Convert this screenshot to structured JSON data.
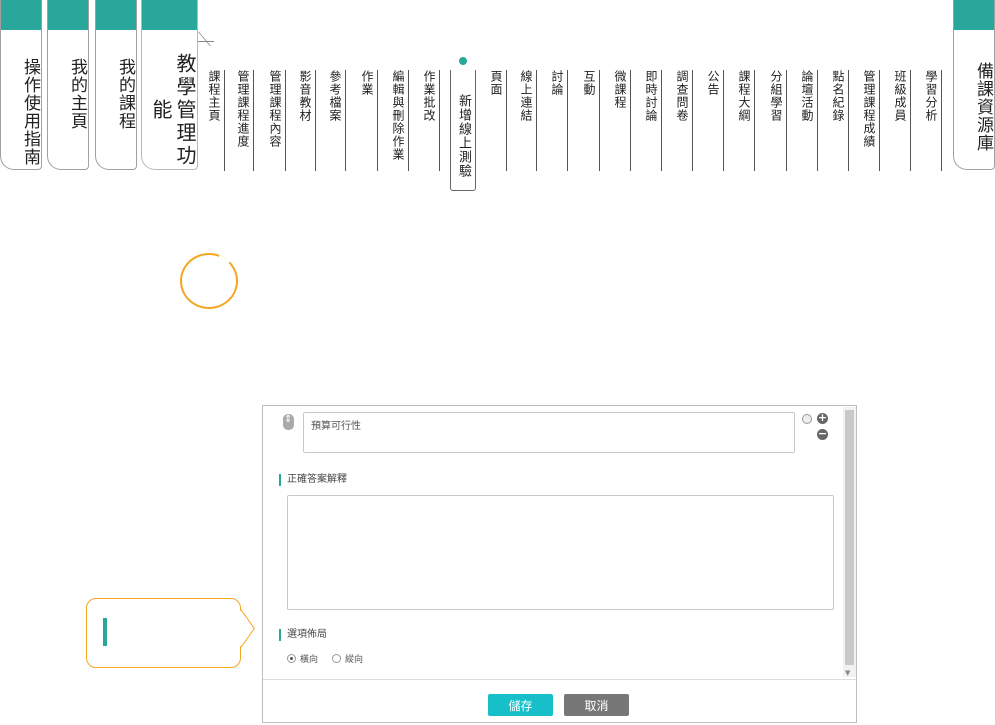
{
  "nav": {
    "main_tabs": [
      {
        "label": "操作使用指南"
      },
      {
        "label": "我的主頁"
      },
      {
        "label": "我的課程"
      },
      {
        "label": "教學管理功能"
      }
    ],
    "resource_tab": "備課資源庫",
    "sub_tabs": [
      "課程主頁",
      "管理課程進度",
      "管理課程內容",
      "影音教材",
      "參考檔案",
      "作業",
      "編輯與刪除作業",
      "作業批改",
      "新增線上測驗",
      "頁面",
      "線上連結",
      "討論",
      "互動",
      "微課程",
      "即時討論",
      "調查問卷",
      "公告",
      "課程大綱",
      "分組學習",
      "論壇活動",
      "點名紀錄",
      "管理課程成績",
      "班級成員",
      "學習分析"
    ],
    "active_sub_tab": "新增線上測驗",
    "accent_color": "#2aa79b"
  },
  "dialog": {
    "option_text": "預算可行性",
    "explanation_title": "正確答案解釋",
    "layout_title": "選項佈局",
    "layout_options": [
      "橫向",
      "縱向"
    ],
    "layout_selected": "橫向",
    "save_label": "儲存",
    "cancel_label": "取消"
  },
  "annotation_color": "#f5a623"
}
